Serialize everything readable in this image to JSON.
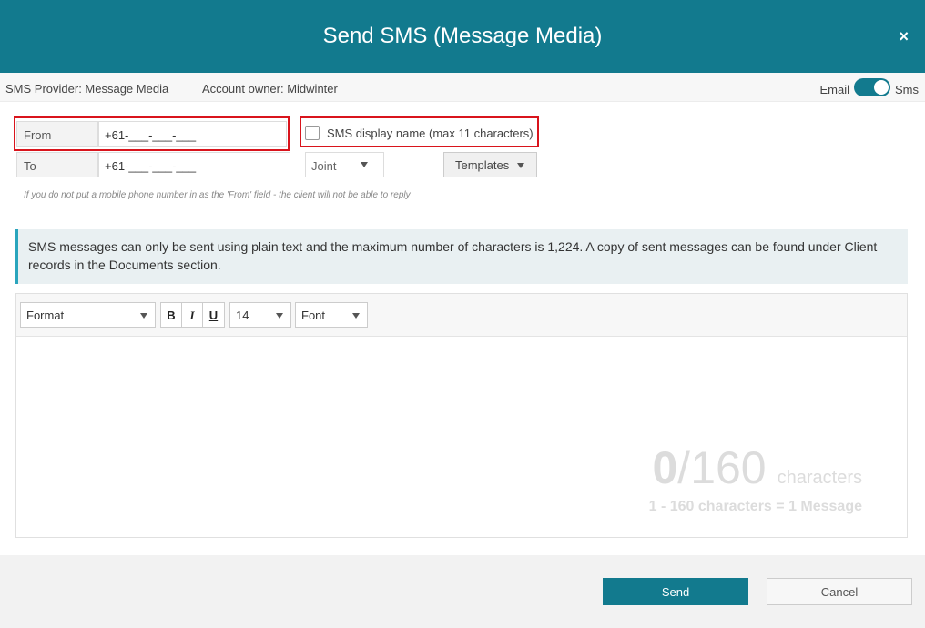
{
  "dialog": {
    "title": "Send SMS (Message Media)",
    "close_glyph": "×"
  },
  "infobar": {
    "provider": "SMS Provider: Message Media",
    "owner": "Account owner: Midwinter",
    "toggle_left_label": "Email",
    "toggle_right_label": "Sms",
    "toggle_state": "Sms"
  },
  "form": {
    "from_label": "From",
    "from_value": "+61-___-___-___",
    "to_label": "To",
    "to_value": "+61-___-___-___",
    "display_name_label": "SMS display name (max 11 characters)",
    "display_name_checked": false,
    "recipient_select": "Joint",
    "templates_label": "Templates",
    "hint": "If you do not put a mobile phone number in as the 'From' field - the client will not be able to reply"
  },
  "alert": {
    "text": "SMS messages can only be sent using plain text and the maximum number of characters is 1,224. A copy of sent messages can be found under Client records in the Documents section."
  },
  "editor": {
    "format_label": "Format",
    "bold_label": "B",
    "italic_label": "I",
    "underline_label": "U",
    "size_value": "14",
    "font_label": "Font",
    "counter_current": "0",
    "counter_max": "/160",
    "counter_unit": "characters",
    "counter_rule": "1 - 160 characters = 1 Message"
  },
  "footer": {
    "send_label": "Send",
    "cancel_label": "Cancel"
  },
  "colors": {
    "brand": "#127a8e",
    "highlight": "#d9141c",
    "alert_accent": "#2aa5bd"
  }
}
